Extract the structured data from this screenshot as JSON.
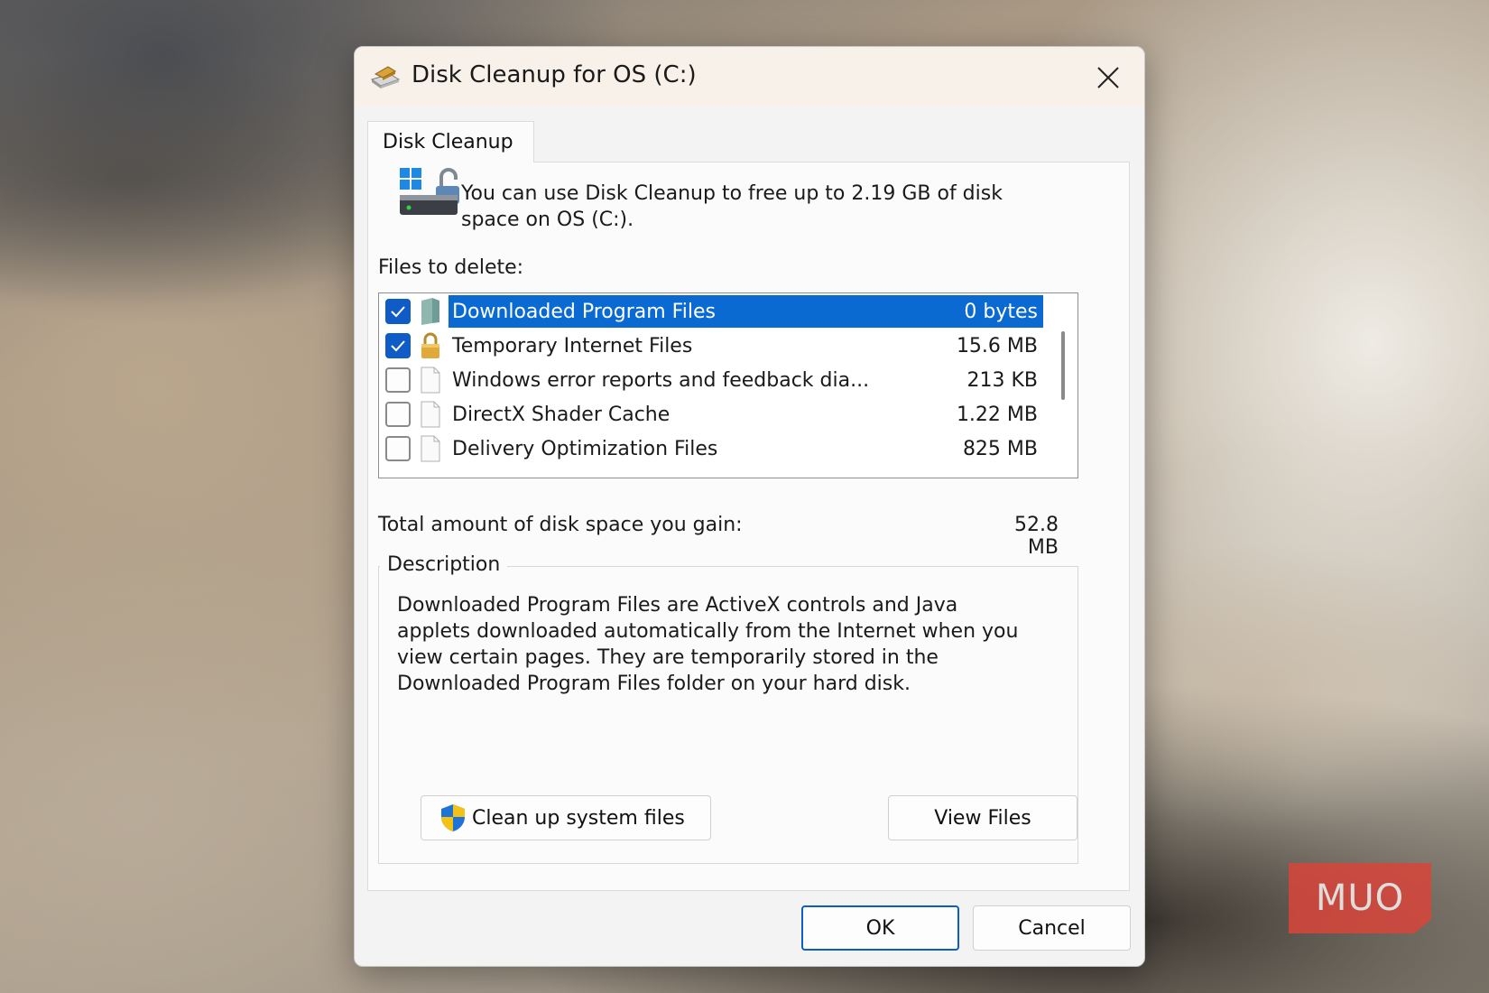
{
  "dialog": {
    "title": "Disk Cleanup for OS (C:)",
    "tab_label": "Disk Cleanup",
    "intro": "You can use Disk Cleanup to free up to 2.19 GB of disk space on OS (C:).",
    "files_label": "Files to delete:",
    "files": [
      {
        "name": "Downloaded Program Files",
        "size": "0 bytes",
        "checked": true,
        "selected": true,
        "icon": "folder-icon"
      },
      {
        "name": "Temporary Internet Files",
        "size": "15.6 MB",
        "checked": true,
        "selected": false,
        "icon": "lock-icon"
      },
      {
        "name": "Windows error reports and feedback dia...",
        "size": "213 KB",
        "checked": false,
        "selected": false,
        "icon": "file-icon"
      },
      {
        "name": "DirectX Shader Cache",
        "size": "1.22 MB",
        "checked": false,
        "selected": false,
        "icon": "file-icon"
      },
      {
        "name": "Delivery Optimization Files",
        "size": "825 MB",
        "checked": false,
        "selected": false,
        "icon": "file-icon"
      }
    ],
    "gain_label": "Total amount of disk space you gain:",
    "gain_value": "52.8 MB",
    "description_legend": "Description",
    "description_text": "Downloaded Program Files are ActiveX controls and Java applets downloaded automatically from the Internet when you view certain pages. They are temporarily stored in the Downloaded Program Files folder on your hard disk.",
    "cleanup_system_label": "Clean up system files",
    "view_files_label": "View Files",
    "ok_label": "OK",
    "cancel_label": "Cancel"
  },
  "watermark": "MUO",
  "colors": {
    "accent": "#0f5cc6",
    "selection": "#0a6ad1",
    "titlebar": "#f7f1e9"
  }
}
